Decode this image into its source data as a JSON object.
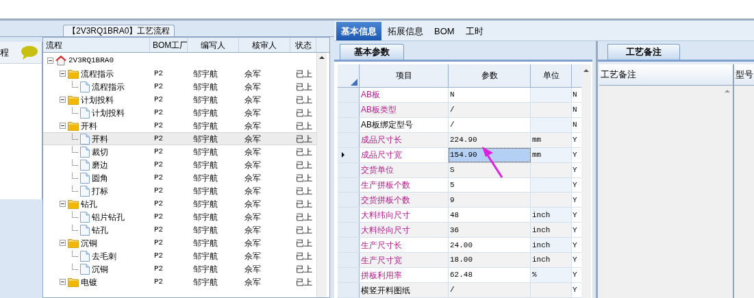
{
  "left_panel": {
    "label": "程"
  },
  "flow_panel": {
    "title": "【2V3RQ1BRA0】工艺流程",
    "columns": [
      "流程",
      "BOM工厂",
      "编写人",
      "核审人",
      "状态"
    ],
    "tree": [
      {
        "name": "2V3RQ1BRA0",
        "kind": "root",
        "expanded": true,
        "selected": false,
        "children": [
          {
            "name": "流程指示",
            "kind": "folder",
            "expanded": true,
            "selected": false,
            "cells": [
              "P2",
              "邹宇航",
              "佘军",
              "已上"
            ],
            "children": [
              {
                "name": "流程指示",
                "kind": "file",
                "selected": false,
                "cells": [
                  "P2",
                  "邹宇航",
                  "佘军",
                  "已上"
                ]
              }
            ]
          },
          {
            "name": "计划投料",
            "kind": "folder",
            "expanded": true,
            "selected": false,
            "cells": [
              "P2",
              "邹宇航",
              "佘军",
              "已上"
            ],
            "children": [
              {
                "name": "计划投料",
                "kind": "file",
                "selected": false,
                "cells": [
                  "P2",
                  "邹宇航",
                  "佘军",
                  "已上"
                ]
              }
            ]
          },
          {
            "name": "开料",
            "kind": "folder",
            "expanded": true,
            "selected": false,
            "cells": [
              "P2",
              "邹宇航",
              "佘军",
              "已上"
            ],
            "children": [
              {
                "name": "开料",
                "kind": "file",
                "selected": true,
                "cells": [
                  "P2",
                  "邹宇航",
                  "佘军",
                  "已上"
                ]
              },
              {
                "name": "裁切",
                "kind": "file",
                "selected": false,
                "cells": [
                  "P2",
                  "邹宇航",
                  "佘军",
                  "已上"
                ]
              },
              {
                "name": "磨边",
                "kind": "file",
                "selected": false,
                "cells": [
                  "P2",
                  "邹宇航",
                  "佘军",
                  "已上"
                ]
              },
              {
                "name": "圆角",
                "kind": "file",
                "selected": false,
                "cells": [
                  "P2",
                  "邹宇航",
                  "佘军",
                  "已上"
                ]
              },
              {
                "name": "打标",
                "kind": "file",
                "selected": false,
                "cells": [
                  "P2",
                  "邹宇航",
                  "佘军",
                  "已上"
                ]
              }
            ]
          },
          {
            "name": "钻孔",
            "kind": "folder",
            "expanded": true,
            "selected": false,
            "cells": [
              "P2",
              "邹宇航",
              "佘军",
              "已上"
            ],
            "children": [
              {
                "name": "铝片钻孔",
                "kind": "file",
                "selected": false,
                "cells": [
                  "P2",
                  "邹宇航",
                  "佘军",
                  "已上"
                ]
              },
              {
                "name": "钻孔",
                "kind": "file",
                "selected": false,
                "cells": [
                  "P2",
                  "邹宇航",
                  "佘军",
                  "已上"
                ]
              }
            ]
          },
          {
            "name": "沉铜",
            "kind": "folder",
            "expanded": true,
            "selected": false,
            "cells": [
              "P2",
              "邹宇航",
              "佘军",
              "已上"
            ],
            "children": [
              {
                "name": "去毛刺",
                "kind": "file",
                "selected": false,
                "cells": [
                  "P2",
                  "邹宇航",
                  "佘军",
                  "已上"
                ]
              },
              {
                "name": "沉铜",
                "kind": "file",
                "selected": false,
                "cells": [
                  "P2",
                  "邹宇航",
                  "佘军",
                  "已上"
                ]
              }
            ]
          },
          {
            "name": "电镀",
            "kind": "folder",
            "expanded": true,
            "selected": false,
            "cells": [
              "P2",
              "邹宇航",
              "佘军",
              "已上"
            ]
          }
        ]
      }
    ]
  },
  "tabs": [
    {
      "label": "基本信息",
      "selected": true
    },
    {
      "label": "拓展信息",
      "selected": false
    },
    {
      "label": "BOM",
      "selected": false
    },
    {
      "label": "工时",
      "selected": false
    }
  ],
  "params": {
    "tab": "基本参数",
    "columns": [
      "项目",
      "参数",
      "单位"
    ],
    "rows": [
      {
        "item": "AB板",
        "required": true,
        "value": "N",
        "unit": "",
        "column_4": "N",
        "selected": false
      },
      {
        "item": "AB板类型",
        "required": true,
        "value": "/",
        "unit": "",
        "column_4": "N",
        "selected": false
      },
      {
        "item": "AB板绑定型号",
        "required": false,
        "value": "/",
        "unit": "",
        "column_4": "N",
        "selected": false
      },
      {
        "item": "成品尺寸长",
        "required": true,
        "value": "224.90",
        "unit": "mm",
        "column_4": "Y",
        "selected": false
      },
      {
        "item": "成品尺寸宽",
        "required": true,
        "value": "154.90",
        "unit": "mm",
        "column_4": "Y",
        "selected": true
      },
      {
        "item": "交货单位",
        "required": true,
        "value": "S",
        "unit": "",
        "column_4": "Y",
        "selected": false
      },
      {
        "item": "生产拼板个数",
        "required": true,
        "value": "5",
        "unit": "",
        "column_4": "Y",
        "selected": false
      },
      {
        "item": "交货拼板个数",
        "required": true,
        "value": "9",
        "unit": "",
        "column_4": "Y",
        "selected": false
      },
      {
        "item": "大料纬向尺寸",
        "required": true,
        "value": "48",
        "unit": "inch",
        "column_4": "Y",
        "selected": false
      },
      {
        "item": "大料经向尺寸",
        "required": true,
        "value": "36",
        "unit": "inch",
        "column_4": "Y",
        "selected": false
      },
      {
        "item": "生产尺寸长",
        "required": true,
        "value": "24.00",
        "unit": "inch",
        "column_4": "Y",
        "selected": false
      },
      {
        "item": "生产尺寸宽",
        "required": true,
        "value": "18.00",
        "unit": "inch",
        "column_4": "Y",
        "selected": false
      },
      {
        "item": "拼板利用率",
        "required": true,
        "value": "62.48",
        "unit": "%",
        "column_4": "Y",
        "selected": false
      },
      {
        "item": "横竖开料图纸",
        "required": false,
        "value": "/",
        "unit": "",
        "column_4": "Y",
        "selected": false
      }
    ]
  },
  "notes_panel": {
    "tab": "工艺备注",
    "columns": [
      "工艺备注",
      "型号"
    ]
  }
}
